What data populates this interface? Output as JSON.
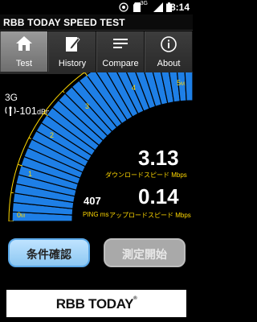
{
  "status_bar": {
    "network": "3G",
    "time": "8:14"
  },
  "title_bar": {
    "title": "RBB TODAY SPEED TEST"
  },
  "tabs": [
    {
      "label": "Test",
      "icon": "home-icon",
      "active": true
    },
    {
      "label": "History",
      "icon": "edit-icon",
      "active": false
    },
    {
      "label": "Compare",
      "icon": "list-icon",
      "active": false
    },
    {
      "label": "About",
      "icon": "info-icon",
      "active": false
    }
  ],
  "signal": {
    "network_type": "3G",
    "strength": "-101",
    "unit": "dBm"
  },
  "gauge": {
    "min_label": "0",
    "min_unit": "M",
    "max_label": "5",
    "max_unit": "M",
    "ticks": [
      "1",
      "2",
      "3",
      "4"
    ],
    "fill_fraction": 1.0,
    "color": "#1e7fe6"
  },
  "download": {
    "value": "3.13",
    "label": "ダウンロードスピード",
    "unit": "Mbps"
  },
  "upload": {
    "value": "0.14",
    "label": "アップロードスピード",
    "unit": "Mbps"
  },
  "ping": {
    "value": "407",
    "label": "PING",
    "unit": "ms"
  },
  "buttons": {
    "condition": "条件確認",
    "start": "測定開始"
  },
  "logo": {
    "text": "RBB TODAY",
    "reg": "®"
  }
}
